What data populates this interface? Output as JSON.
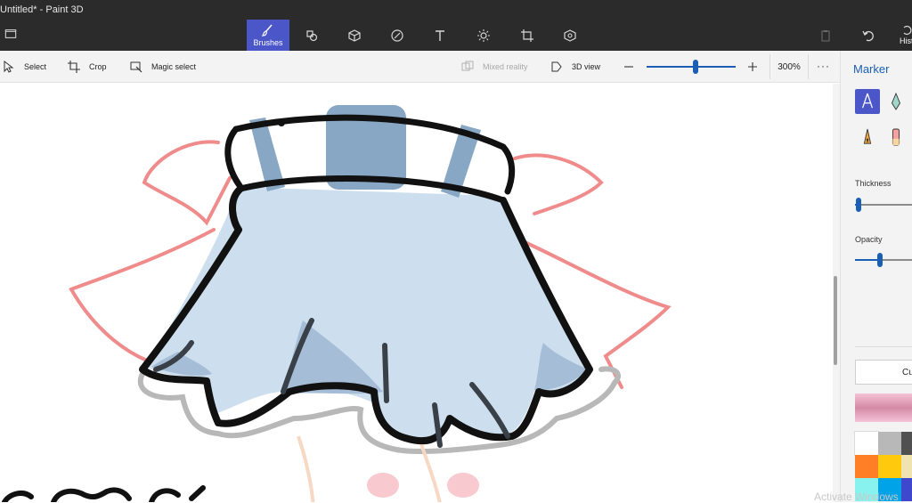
{
  "app": {
    "title": "Untitled* - Paint 3D"
  },
  "main_toolbar": {
    "active_tool_label": "Brushes",
    "history_label": "Hist"
  },
  "sub_toolbar": {
    "select_label": "Select",
    "crop_label": "Crop",
    "magic_select_label": "Magic select",
    "mixed_reality_label": "Mixed reality",
    "view_3d_label": "3D view",
    "zoom_value": "300%",
    "zoom_fraction": 0.55
  },
  "side_panel": {
    "title": "Marker",
    "thickness_label": "Thickness",
    "thickness_fraction": 0.05,
    "opacity_label": "Opacity",
    "opacity_fraction": 0.35,
    "custom_label": "Cu",
    "current_color": "#e8a5bf",
    "palette": [
      "#ffffff",
      "#b8b8b8",
      "#505050",
      "#ff7f27",
      "#ffc90e",
      "#efe4b0",
      "#88f3ee",
      "#00a2e8",
      "#3f48cc"
    ]
  },
  "watermark": "Activate Windows",
  "colors": {
    "toolbar_dark": "#2b2b2b",
    "accent": "#4b56c8",
    "link_blue": "#1a5fb4",
    "dress_fill": "#cddfee",
    "dress_shade": "#88a7c4",
    "bow_red": "#f08b8b",
    "frill_grey": "#b8b8b8"
  }
}
